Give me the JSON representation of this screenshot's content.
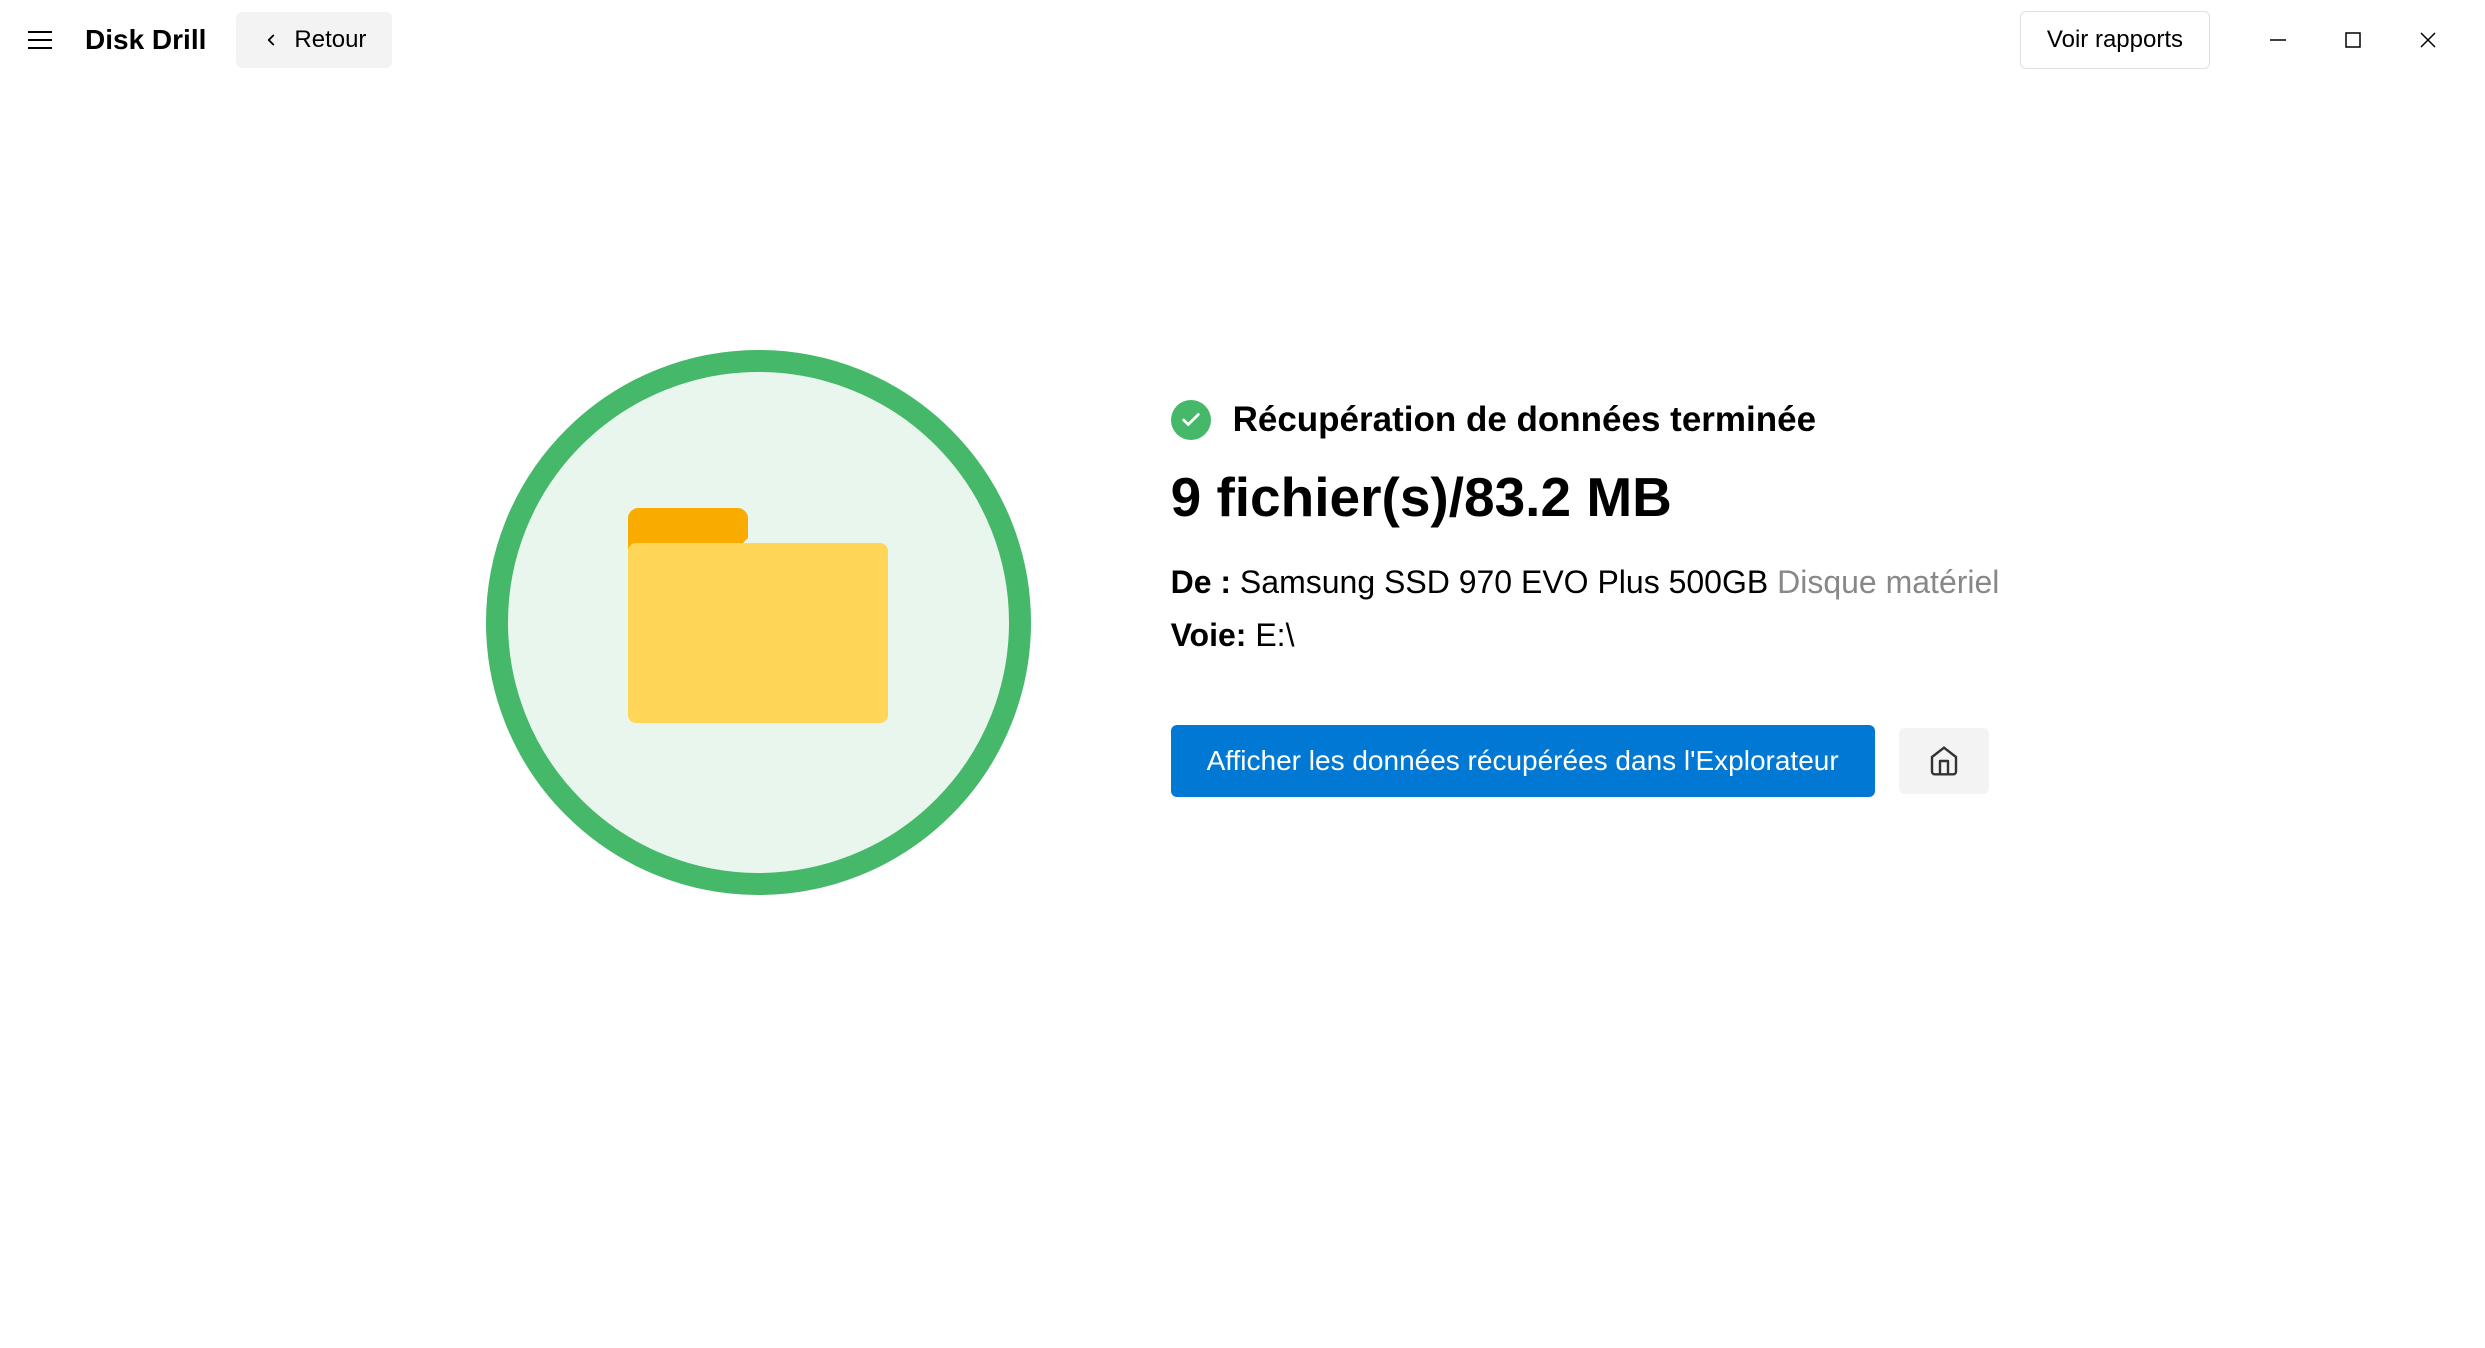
{
  "header": {
    "app_title": "Disk Drill",
    "back_label": "Retour",
    "reports_label": "Voir rapports"
  },
  "status": {
    "text": "Récupération de données terminée"
  },
  "result": {
    "headline": "9 fichier(s)/83.2 MB",
    "source_label": "De :",
    "source_value": "Samsung SSD 970 EVO Plus 500GB",
    "source_type": "Disque matériel",
    "path_label": "Voie:",
    "path_value": "E:\\"
  },
  "actions": {
    "show_in_explorer": "Afficher les données récupérées dans l'Explorateur"
  }
}
